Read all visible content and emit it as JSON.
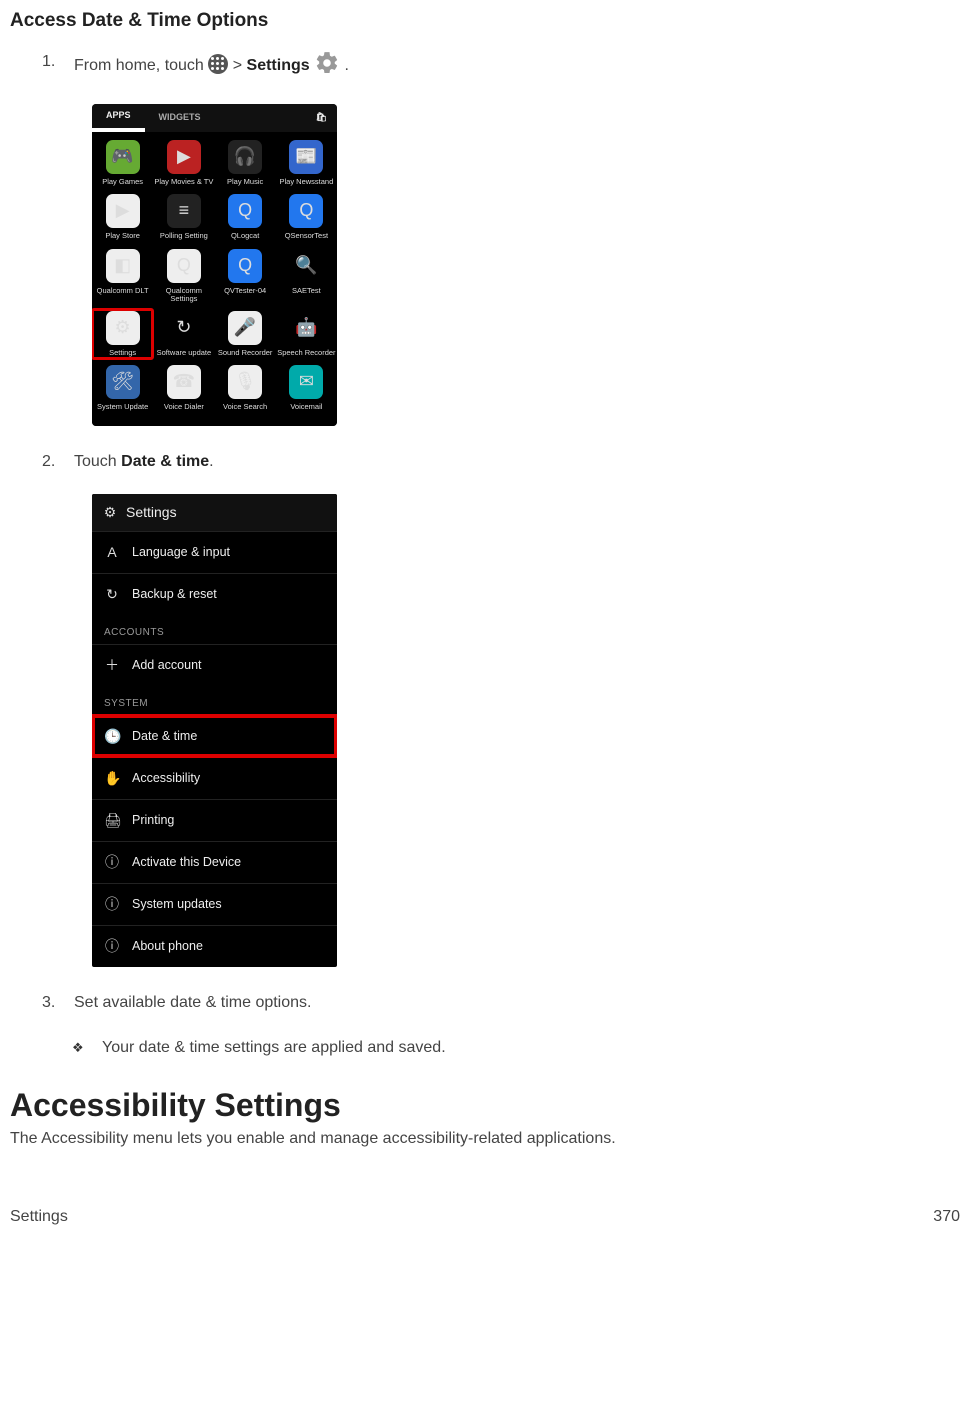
{
  "section_title": "Access Date & Time Options",
  "steps": {
    "s1": {
      "num": "1.",
      "pre": "From home, touch ",
      "mid": " > ",
      "settings": "Settings",
      "post": " ."
    },
    "s2": {
      "num": "2.",
      "pre": "Touch ",
      "bold": "Date & time",
      "post": "."
    },
    "s3": {
      "num": "3.",
      "text": "Set available date & time options."
    }
  },
  "result": "Your date & time settings are applied and saved.",
  "big_heading": "Accessibility Settings",
  "body_text": "The Accessibility menu lets you enable and manage accessibility-related applications.",
  "footer": {
    "left": "Settings",
    "right": "370"
  },
  "shot1": {
    "tabs": {
      "apps": "APPS",
      "widgets": "WIDGETS"
    },
    "apps": [
      {
        "label": "Play Games",
        "bg": "#6a3",
        "glyph": "🎮"
      },
      {
        "label": "Play Movies & TV",
        "bg": "#b22",
        "glyph": "▶"
      },
      {
        "label": "Play Music",
        "bg": "#222",
        "glyph": "🎧"
      },
      {
        "label": "Play Newsstand",
        "bg": "#36c",
        "glyph": "📰"
      },
      {
        "label": "Play Store",
        "bg": "#eee",
        "glyph": "▶"
      },
      {
        "label": "Polling Setting",
        "bg": "#222",
        "glyph": "≡"
      },
      {
        "label": "QLogcat",
        "bg": "#27e",
        "glyph": "Q"
      },
      {
        "label": "QSensorTest",
        "bg": "#27e",
        "glyph": "Q"
      },
      {
        "label": "Qualcomm DLT",
        "bg": "#eee",
        "glyph": "◧"
      },
      {
        "label": "Qualcomm Settings",
        "bg": "#eee",
        "glyph": "Q"
      },
      {
        "label": "QVTester-04",
        "bg": "#27e",
        "glyph": "Q"
      },
      {
        "label": "SAETest",
        "bg": "#000",
        "glyph": "🔍"
      },
      {
        "label": "Settings",
        "bg": "#eee",
        "glyph": "⚙",
        "selected": true
      },
      {
        "label": "Software update",
        "bg": "#000",
        "glyph": "↻"
      },
      {
        "label": "Sound Recorder",
        "bg": "#eee",
        "glyph": "🎤"
      },
      {
        "label": "Speech Recorder",
        "bg": "#000",
        "glyph": "🤖"
      },
      {
        "label": "System Update",
        "bg": "#36a",
        "glyph": "🛠"
      },
      {
        "label": "Voice Dialer",
        "bg": "#eee",
        "glyph": "☎"
      },
      {
        "label": "Voice Search",
        "bg": "#eee",
        "glyph": "🎙"
      },
      {
        "label": "Voicemail",
        "bg": "#0aa",
        "glyph": "✉"
      }
    ]
  },
  "shot2": {
    "title": "Settings",
    "rows": [
      {
        "type": "row",
        "icon": "A",
        "label": "Language & input"
      },
      {
        "type": "row",
        "icon": "↻",
        "label": "Backup & reset"
      },
      {
        "type": "sect",
        "label": "ACCOUNTS"
      },
      {
        "type": "row",
        "icon": "＋",
        "label": "Add account"
      },
      {
        "type": "sect",
        "label": "SYSTEM"
      },
      {
        "type": "row",
        "icon": "🕒",
        "label": "Date & time",
        "hl": true
      },
      {
        "type": "row",
        "icon": "✋",
        "label": "Accessibility"
      },
      {
        "type": "row",
        "icon": "🖨",
        "label": "Printing"
      },
      {
        "type": "row",
        "icon": "ⓘ",
        "label": "Activate this Device"
      },
      {
        "type": "row",
        "icon": "ⓘ",
        "label": "System updates"
      },
      {
        "type": "row",
        "icon": "ⓘ",
        "label": "About phone"
      }
    ]
  }
}
